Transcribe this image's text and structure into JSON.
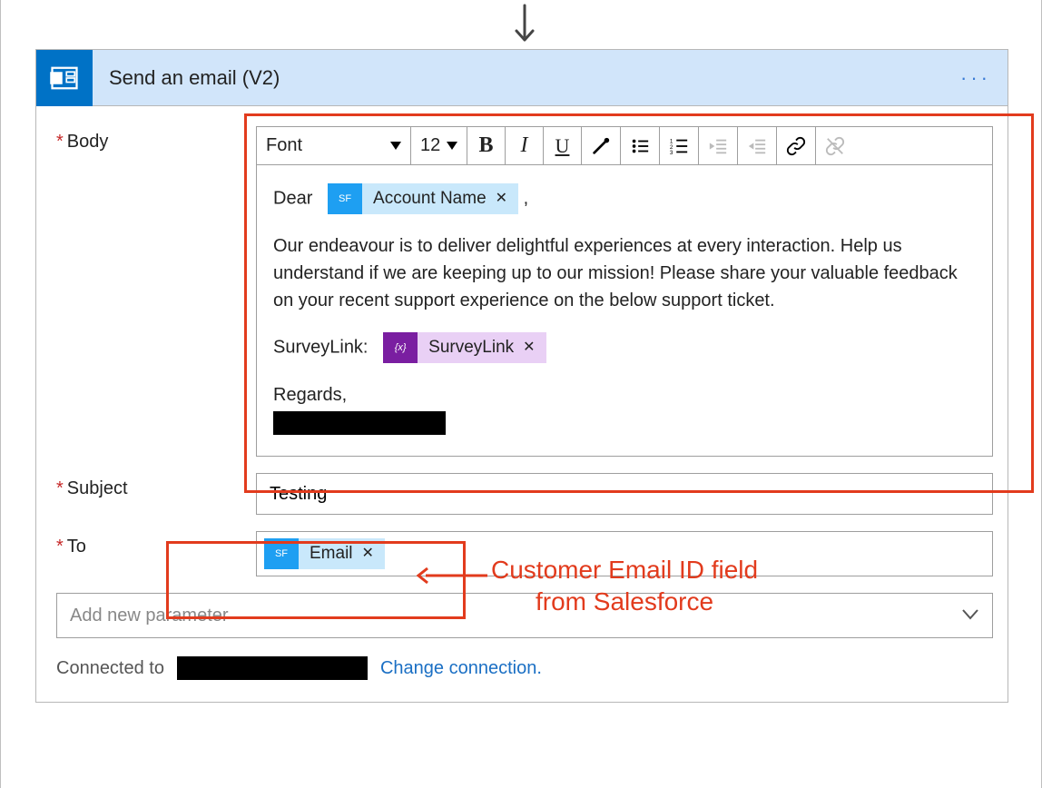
{
  "header": {
    "title": "Send an email (V2)"
  },
  "labels": {
    "body": "Body",
    "subject": "Subject",
    "to": "To",
    "add_param": "Add new parameter",
    "connected_to": "Connected to",
    "change_conn": "Change connection."
  },
  "toolbar": {
    "font": "Font",
    "size": "12"
  },
  "body_content": {
    "greeting": "Dear",
    "account_token": "Account Name",
    "greeting_suffix": ",",
    "paragraph": "Our endeavour is to deliver delightful experiences at every interaction. Help us understand if we are keeping up to our mission! Please share your valuable feedback on your recent support experience on the below support ticket.",
    "surveylink_label": "SurveyLink:",
    "surveylink_token": "SurveyLink",
    "regards": "Regards,"
  },
  "fields": {
    "subject": "Testing",
    "to_token": "Email"
  },
  "annotations": {
    "callout": "Customer Email ID field\nfrom Salesforce"
  }
}
